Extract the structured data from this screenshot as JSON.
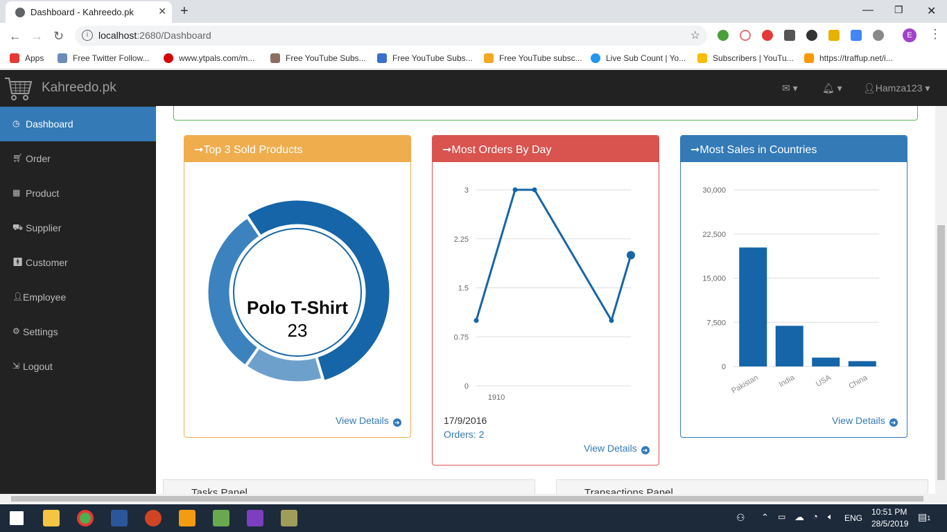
{
  "browser": {
    "tab_title": "Dashboard - Kahreedo.pk",
    "url_host": "localhost",
    "url_path": ":2680/Dashboard",
    "bookmarks": [
      "Apps",
      "Free Twitter Follow...",
      "www.ytpals.com/m...",
      "Free YouTube Subs...",
      "Free YouTube Subs...",
      "Free YouTube subsc...",
      "Live Sub Count | Yo...",
      "Subscribers | YouTu...",
      "https://traffup.net/i..."
    ],
    "profile_initial": "E"
  },
  "app": {
    "brand": "Kahreedo.pk",
    "user": "Hamza123"
  },
  "sidebar": {
    "items": [
      {
        "label": "Dashboard",
        "icon": "dashboard-icon"
      },
      {
        "label": "Order",
        "icon": "cart-icon"
      },
      {
        "label": "Product",
        "icon": "table-icon"
      },
      {
        "label": "Supplier",
        "icon": "truck-icon"
      },
      {
        "label": "Customer",
        "icon": "person-icon"
      },
      {
        "label": "Employee",
        "icon": "user-icon"
      },
      {
        "label": "Settings",
        "icon": "gear-icon"
      },
      {
        "label": "Logout",
        "icon": "logout-icon"
      }
    ]
  },
  "panels": {
    "top_products": {
      "title": "Top 3 Sold Products",
      "center_name": "Polo T-Shirt",
      "center_value": "23",
      "view_details": "View Details",
      "color": "#f0ad4e"
    },
    "orders_by_day": {
      "title": "Most Orders By Day",
      "date": "17/9/2016",
      "orders": "Orders: 2",
      "view_details": "View Details",
      "color": "#d9534f"
    },
    "sales_countries": {
      "title": "Most Sales in Countries",
      "view_details": "View Details",
      "color": "#337ab7"
    }
  },
  "bottom": {
    "tasks": "Tasks Panel",
    "transactions": "Transactions Panel"
  },
  "taskbar": {
    "time": "10:51 PM",
    "date": "28/5/2019",
    "lang": "ENG",
    "notifications": "1"
  },
  "chart_data": [
    {
      "type": "pie",
      "variant": "donut",
      "labels": [
        "Polo T-Shirt",
        "",
        ""
      ],
      "values": [
        23,
        6,
        13
      ],
      "colors": [
        "#1565a8",
        "#6ea0cc",
        "#3b82bf"
      ]
    },
    {
      "type": "line",
      "x": [
        1,
        2,
        3,
        4,
        5
      ],
      "y": [
        1,
        3,
        3,
        1,
        2
      ],
      "xtick_labels": [
        "1910"
      ],
      "yticks": [
        "0",
        "0.75",
        "1.5",
        "2.25",
        "3"
      ],
      "ylim": [
        0,
        3
      ],
      "color": "#1565a8"
    },
    {
      "type": "bar",
      "categories": [
        "Pakistan",
        "India",
        "USA",
        "China"
      ],
      "values": [
        20200,
        6900,
        1500,
        900
      ],
      "yticks": [
        "0",
        "7,500",
        "15,000",
        "22,500",
        "30,000"
      ],
      "ylim": [
        0,
        30000
      ],
      "color": "#1565a8"
    }
  ]
}
